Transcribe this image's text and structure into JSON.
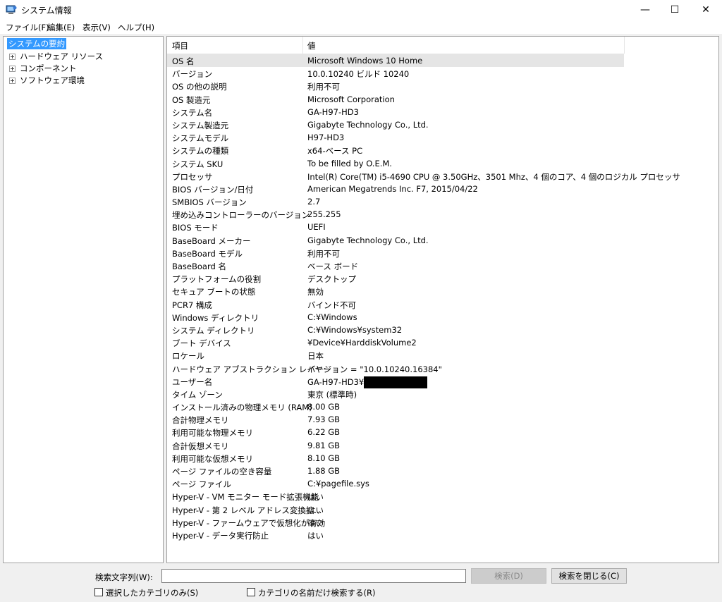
{
  "window": {
    "title": "システム情報",
    "minimize": "—",
    "maximize": "☐",
    "close": "✕"
  },
  "menu": [
    "ファイル(F)",
    "編集(E)",
    "表示(V)",
    "ヘルプ(H)"
  ],
  "tree": {
    "root": "システムの要約",
    "children": [
      "ハードウェア リソース",
      "コンポーネント",
      "ソフトウェア環境"
    ]
  },
  "table": {
    "headers": {
      "item": "項目",
      "value": "値"
    },
    "rows": [
      {
        "item": "OS 名",
        "value": "Microsoft Windows 10 Home"
      },
      {
        "item": "バージョン",
        "value": "10.0.10240 ビルド 10240"
      },
      {
        "item": "OS の他の説明",
        "value": "利用不可"
      },
      {
        "item": "OS 製造元",
        "value": "Microsoft Corporation"
      },
      {
        "item": "システム名",
        "value": "GA-H97-HD3"
      },
      {
        "item": "システム製造元",
        "value": "Gigabyte Technology Co., Ltd."
      },
      {
        "item": "システムモデル",
        "value": "H97-HD3"
      },
      {
        "item": "システムの種類",
        "value": "x64-ベース PC"
      },
      {
        "item": "システム SKU",
        "value": "To be filled by O.E.M."
      },
      {
        "item": "プロセッサ",
        "value": "Intel(R) Core(TM) i5-4690 CPU @ 3.50GHz、3501 Mhz、4 個のコア、4 個のロジカル プロセッサ"
      },
      {
        "item": "BIOS バージョン/日付",
        "value": "American Megatrends Inc. F7, 2015/04/22"
      },
      {
        "item": "SMBIOS バージョン",
        "value": "2.7"
      },
      {
        "item": "埋め込みコントローラーのバージョン",
        "value": "255.255"
      },
      {
        "item": "BIOS モード",
        "value": "UEFI"
      },
      {
        "item": "BaseBoard メーカー",
        "value": "Gigabyte Technology Co., Ltd."
      },
      {
        "item": "BaseBoard モデル",
        "value": "利用不可"
      },
      {
        "item": "BaseBoard 名",
        "value": "ベース ボード"
      },
      {
        "item": "プラットフォームの役割",
        "value": "デスクトップ"
      },
      {
        "item": "セキュア ブートの状態",
        "value": "無効"
      },
      {
        "item": "PCR7 構成",
        "value": "バインド不可"
      },
      {
        "item": "Windows ディレクトリ",
        "value": "C:¥Windows"
      },
      {
        "item": "システム ディレクトリ",
        "value": "C:¥Windows¥system32"
      },
      {
        "item": "ブート デバイス",
        "value": "¥Device¥HarddiskVolume2"
      },
      {
        "item": "ロケール",
        "value": "日本"
      },
      {
        "item": "ハードウェア アブストラクション レイヤー",
        "value": "バージョン = \"10.0.10240.16384\""
      },
      {
        "item": "ユーザー名",
        "value": "GA-H97-HD3¥"
      },
      {
        "item": "タイム ゾーン",
        "value": "東京 (標準時)"
      },
      {
        "item": "インストール済みの物理メモリ (RAM)",
        "value": "8.00 GB"
      },
      {
        "item": "合計物理メモリ",
        "value": "7.93 GB"
      },
      {
        "item": "利用可能な物理メモリ",
        "value": "6.22 GB"
      },
      {
        "item": "合計仮想メモリ",
        "value": "9.81 GB"
      },
      {
        "item": "利用可能な仮想メモリ",
        "value": "8.10 GB"
      },
      {
        "item": "ページ ファイルの空き容量",
        "value": "1.88 GB"
      },
      {
        "item": "ページ ファイル",
        "value": "C:¥pagefile.sys"
      },
      {
        "item": "Hyper-V - VM モニター モード拡張機能",
        "value": "はい"
      },
      {
        "item": "Hyper-V - 第 2 レベル アドレス変換拡...",
        "value": "はい"
      },
      {
        "item": "Hyper-V - ファームウェアで仮想化が有効",
        "value": "はい"
      },
      {
        "item": "Hyper-V - データ実行防止",
        "value": "はい"
      }
    ]
  },
  "search": {
    "label": "検索文字列(W):",
    "value": "",
    "search_button": "検索(D)",
    "close_button": "検索を閉じる(C)",
    "selected_category_only": "選択したカテゴリのみ(S)",
    "category_names_only": "カテゴリの名前だけ検索する(R)"
  }
}
